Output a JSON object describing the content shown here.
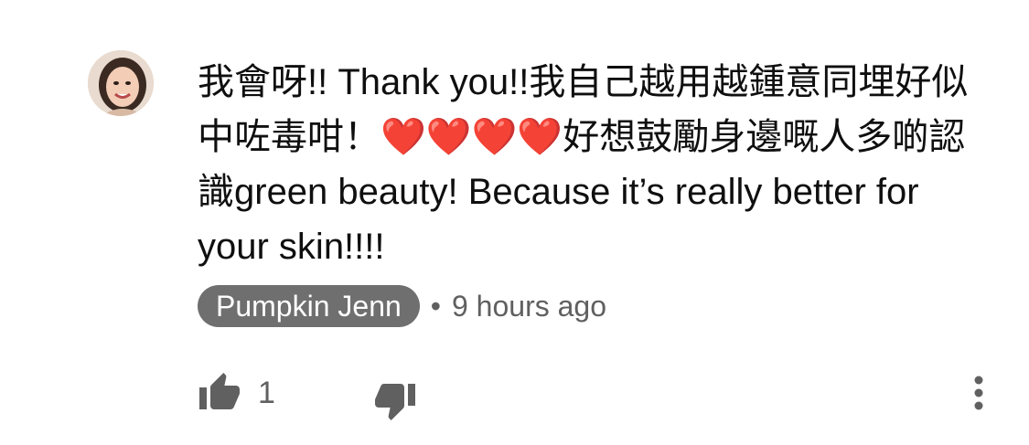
{
  "comment": {
    "text": "我會呀!! Thank you!!我自己越用越鍾意同埋好似中咗毒咁！❤️❤️❤️❤️好想鼓勵身邊嘅人多啲認識green beauty! Because it’s really better for your skin!!!!",
    "author": "Pumpkin Jenn",
    "separator": "•",
    "timestamp": "9 hours ago",
    "like_count": "1"
  },
  "icons": {
    "avatar": "avatar",
    "like": "thumbs-up-icon",
    "dislike": "thumbs-down-icon",
    "more": "more-vertical-icon"
  },
  "colors": {
    "chip_background": "#6f6f6f",
    "secondary_text": "#606060",
    "icon": "#606060"
  }
}
